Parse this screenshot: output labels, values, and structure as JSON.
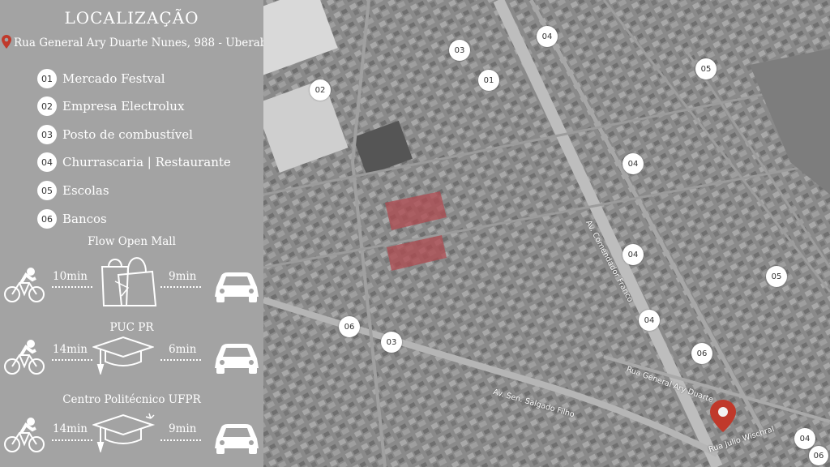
{
  "panel": {
    "title": "LOCALIZAÇÃO",
    "address": "Rua General Ary Duarte Nunes, 988 - Uberaba",
    "legend": [
      {
        "num": "01",
        "label": "Mercado Festval"
      },
      {
        "num": "02",
        "label": "Empresa Electrolux"
      },
      {
        "num": "03",
        "label": "Posto de combustível"
      },
      {
        "num": "04",
        "label": "Churrascaria | Restaurante"
      },
      {
        "num": "05",
        "label": "Escolas"
      },
      {
        "num": "06",
        "label": "Bancos"
      }
    ],
    "destinations": [
      {
        "name": "Flow Open Mall",
        "bike_time": "10min",
        "car_time": "9min",
        "icon": "shopping-bags-icon"
      },
      {
        "name": "PUC PR",
        "bike_time": "14min",
        "car_time": "6min",
        "icon": "graduation-cap-icon"
      },
      {
        "name": "Centro Politécnico UFPR",
        "bike_time": "14min",
        "car_time": "9min",
        "icon": "graduation-cap-icon"
      }
    ]
  },
  "map": {
    "markers": [
      "03",
      "01",
      "02",
      "04",
      "05",
      "04",
      "04",
      "05",
      "04",
      "06",
      "03",
      "06",
      "04",
      "06"
    ],
    "streets": [
      "Av. Comendador Franco",
      "Rua General Ary Duarte",
      "Av. Sen. Salgado Filho",
      "Rua Julio Wischral"
    ],
    "location_pin_color": "#c0392b"
  },
  "colors": {
    "panel_bg": "#a3a3a3",
    "text": "#ffffff",
    "pin": "#c0392b"
  }
}
